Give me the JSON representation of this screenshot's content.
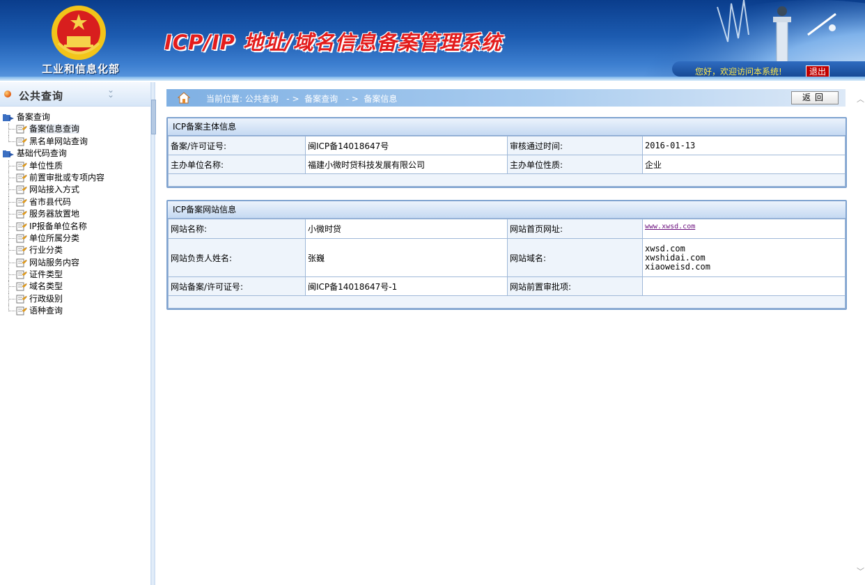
{
  "header": {
    "ministry": "工业和信息化部",
    "system_title": "ICP/IP 地址/域名信息备案管理系统",
    "welcome": "您好，欢迎访问本系统!",
    "logout": "退出"
  },
  "sidebar": {
    "title": "公共查询",
    "groups": [
      {
        "label": "备案查询",
        "items": [
          "备案信息查询",
          "黑名单网站查询"
        ]
      },
      {
        "label": "基础代码查询",
        "items": [
          "单位性质",
          "前置审批或专项内容",
          "网站接入方式",
          "省市县代码",
          "服务器放置地",
          "IP报备单位名称",
          "单位所属分类",
          "行业分类",
          "网站服务内容",
          "证件类型",
          "域名类型",
          "行政级别",
          "语种查询"
        ]
      }
    ]
  },
  "breadcrumb": {
    "text": "当前位置: 公共查询   - >  备案查询   - >  备案信息",
    "back": "返回"
  },
  "subject": {
    "title": "ICP备案主体信息",
    "license_label": "备案/许可证号:",
    "license_value": "闽ICP备14018647号",
    "approve_label": "审核通过时间:",
    "approve_value": "2016-01-13",
    "org_label": "主办单位名称:",
    "org_value": "福建小微时贷科技发展有限公司",
    "nature_label": "主办单位性质:",
    "nature_value": "企业"
  },
  "site": {
    "title": "ICP备案网站信息",
    "name_label": "网站名称:",
    "name_value": "小微时贷",
    "home_label": "网站首页网址:",
    "home_value": "www.xwsd.com",
    "owner_label": "网站负责人姓名:",
    "owner_value": "张巍",
    "domain_label": "网站域名:",
    "domains": [
      "xwsd.com",
      "xwshidai.com",
      "xiaoweisd.com"
    ],
    "license_label": "网站备案/许可证号:",
    "license_value": "闽ICP备14018647号-1",
    "preapprove_label": "网站前置审批项:",
    "preapprove_value": ""
  },
  "colors": {
    "header_blue": "#1c5bb0",
    "title_red": "#e31c1c",
    "welcome_yellow": "#ffe94a",
    "panel_border": "#7ea2cf"
  }
}
